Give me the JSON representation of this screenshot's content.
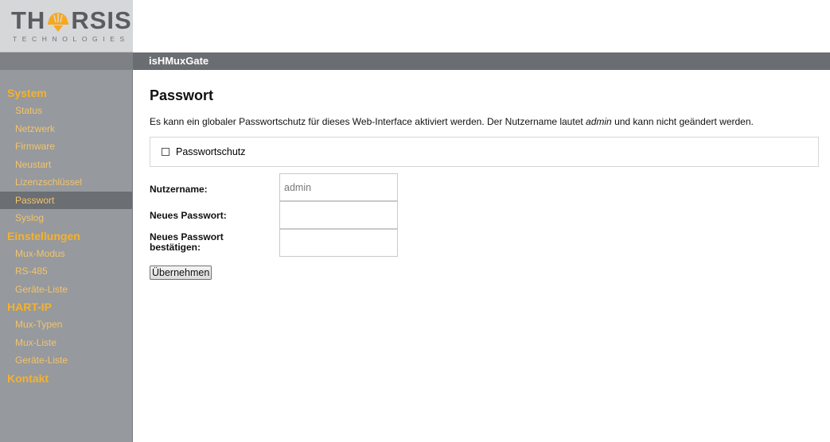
{
  "logo": {
    "brand_left": "TH",
    "brand_right": "RSIS",
    "tagline": "TECHNOLOGIES"
  },
  "header": {
    "title": "isHMuxGate"
  },
  "nav": {
    "groups": [
      {
        "label": "System",
        "items": [
          "Status",
          "Netzwerk",
          "Firmware",
          "Neustart",
          "Lizenzschlüssel",
          "Passwort",
          "Syslog"
        ]
      },
      {
        "label": "Einstellungen",
        "items": [
          "Mux-Modus",
          "RS-485",
          "Geräte-Liste"
        ]
      },
      {
        "label": "HART-IP",
        "items": [
          "Mux-Typen",
          "Mux-Liste",
          "Geräte-Liste"
        ]
      },
      {
        "label": "Kontakt",
        "items": []
      }
    ],
    "active_item": "Passwort"
  },
  "page": {
    "title": "Passwort",
    "desc_before": "Es kann ein globaler Passwortschutz für dieses Web-Interface aktiviert werden. Der Nutzername lautet ",
    "desc_em": "admin",
    "desc_after": " und kann nicht geändert werden.",
    "checkbox_label": "Passwortschutz",
    "checkbox_checked": false,
    "form": {
      "username_label": "Nutzername:",
      "username_placeholder": "admin",
      "new_password_label": "Neues Passwort:",
      "confirm_label_line1": "Neues Passwort",
      "confirm_label_line2": "bestätigen:"
    },
    "submit_label": "Übernehmen"
  },
  "colors": {
    "accent": "#f6b22b",
    "sidebar": "#96999d",
    "topbar": "#6a6d71",
    "active_item": "#6b6e72"
  }
}
